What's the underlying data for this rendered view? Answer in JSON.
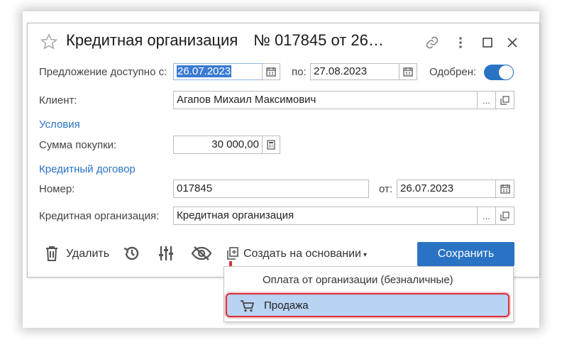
{
  "header": {
    "title": "Кредитная организация",
    "doc_number": "№ 017845 от 26…"
  },
  "form": {
    "offer_label": "Предложение доступно с:",
    "offer_from": "26.07.2023",
    "to_label": "по:",
    "offer_to": "27.08.2023",
    "approved_label": "Одобрен:",
    "approved": true,
    "client_label": "Клиент:",
    "client_value": "Агапов Михаил Максимович",
    "section_terms": "Условия",
    "purchase_label": "Сумма покупки:",
    "purchase_value": "30 000,00",
    "section_contract": "Кредитный договор",
    "number_label": "Номер:",
    "number_value": "017845",
    "date_label": "от:",
    "date_value": "26.07.2023",
    "org_label": "Кредитная организация:",
    "org_value": "Кредитная организация",
    "dots": "..."
  },
  "toolbar": {
    "delete_label": "Удалить",
    "create_based_label": "Создать на основании",
    "save_label": "Сохранить"
  },
  "menu": {
    "items": [
      {
        "label": "Оплата от организации (безналичные)"
      },
      {
        "label": "Продажа"
      }
    ]
  },
  "colors": {
    "accent": "#2a73c4",
    "highlight": "#b9d3f2",
    "annotation": "#d9323a"
  }
}
